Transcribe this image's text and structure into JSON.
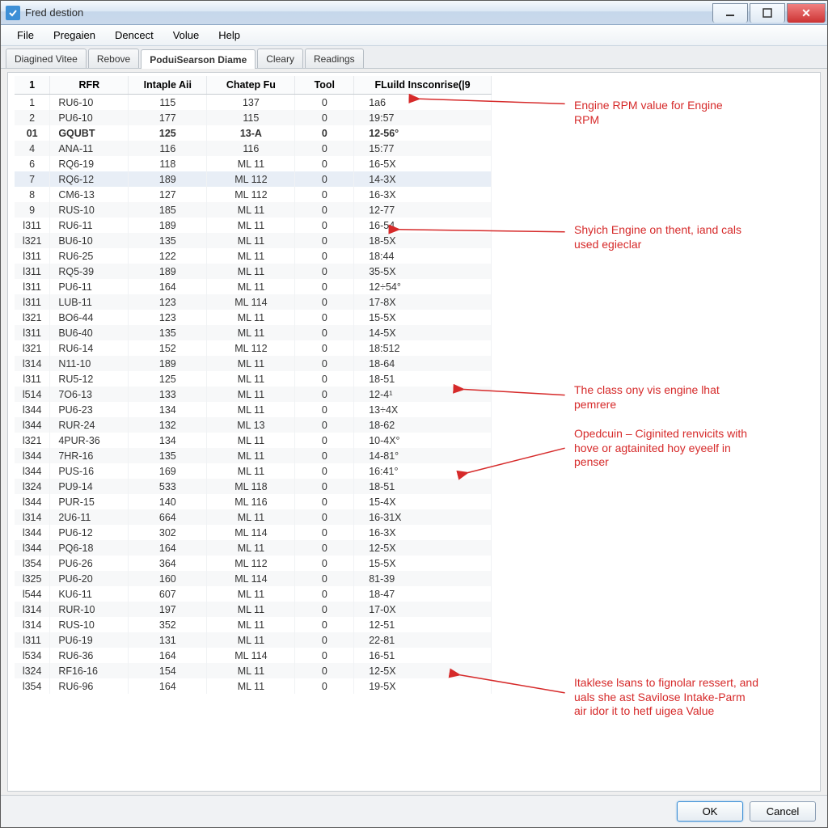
{
  "window": {
    "title": "Fred destion"
  },
  "menu": {
    "file": "File",
    "pregaian": "Pregaien",
    "dencect": "Dencect",
    "volue": "Volue",
    "help": "Help"
  },
  "tabs": {
    "diagined": "Diagined Vitee",
    "rebove": "Rebove",
    "podui": "PoduiSearson Diame",
    "cleary": "Cleary",
    "readings": "Readings"
  },
  "headers": {
    "col0": "1",
    "col1": "RFR",
    "col2": "Intaple Aii",
    "col3": "Chatep Fu",
    "col4": "Tool",
    "col5": "FLuild Insconrise(|9"
  },
  "rows": [
    {
      "n": "1",
      "c1": "RU6-10",
      "c2": "115",
      "c3": "137",
      "c4": "0",
      "c5": "1a6",
      "hl": true
    },
    {
      "n": "2",
      "c1": "PU6-10",
      "c2": "177",
      "c3": "115",
      "c4": "0",
      "c5": "19:57"
    },
    {
      "n": "01",
      "c1": "GQUBT",
      "c2": "125",
      "c3": "13-A",
      "c4": "0",
      "c5": "12-56°",
      "bold": true
    },
    {
      "n": "4",
      "c1": "ANA-11",
      "c2": "116",
      "c3": "116",
      "c4": "0",
      "c5": "15:77"
    },
    {
      "n": "6",
      "c1": "RQ6-19",
      "c2": "118",
      "c3": "ML 11",
      "c4": "0",
      "c5": "16-5X"
    },
    {
      "n": "7",
      "c1": "RQ6-12",
      "c2": "189",
      "c3": "ML 112",
      "c4": "0",
      "c5": "14-3X",
      "sel": true
    },
    {
      "n": "8",
      "c1": "CM6-13",
      "c2": "127",
      "c3": "ML 112",
      "c4": "0",
      "c5": "16-3X"
    },
    {
      "n": "9",
      "c1": "RUS-10",
      "c2": "185",
      "c3": "ML 11",
      "c4": "0",
      "c5": "12-77",
      "hl": true
    },
    {
      "n": "l311",
      "c1": "RU6-11",
      "c2": "189",
      "c3": "ML 11",
      "c4": "0",
      "c5": "16-54"
    },
    {
      "n": "l321",
      "c1": "BU6-10",
      "c2": "135",
      "c3": "ML 11",
      "c4": "0",
      "c5": "18-5X"
    },
    {
      "n": "l311",
      "c1": "RU6-25",
      "c2": "122",
      "c3": "ML 11",
      "c4": "0",
      "c5": "18:44"
    },
    {
      "n": "l311",
      "c1": "RQ5-39",
      "c2": "189",
      "c3": "ML 11",
      "c4": "0",
      "c5": "35-5X"
    },
    {
      "n": "l311",
      "c1": "PU6-11",
      "c2": "164",
      "c3": "ML 11",
      "c4": "0",
      "c5": "12÷54°"
    },
    {
      "n": "l311",
      "c1": "LUB-11",
      "c2": "123",
      "c3": "ML 114",
      "c4": "0",
      "c5": "17-8X"
    },
    {
      "n": "l321",
      "c1": "BO6-44",
      "c2": "123",
      "c3": "ML 11",
      "c4": "0",
      "c5": "15-5X"
    },
    {
      "n": "l311",
      "c1": "BU6-40",
      "c2": "135",
      "c3": "ML 11",
      "c4": "0",
      "c5": "14-5X"
    },
    {
      "n": "l321",
      "c1": "RU6-14",
      "c2": "152",
      "c3": "ML 112",
      "c4": "0",
      "c5": "18:512",
      "hl": true
    },
    {
      "n": "l314",
      "c1": "N11-10",
      "c2": "189",
      "c3": "ML 11",
      "c4": "0",
      "c5": "18-64"
    },
    {
      "n": "l311",
      "c1": "RU5-12",
      "c2": "125",
      "c3": "ML 11",
      "c4": "0",
      "c5": "18-51"
    },
    {
      "n": "l514",
      "c1": "7O6-13",
      "c2": "133",
      "c3": "ML 11",
      "c4": "0",
      "c5": "12-4¹"
    },
    {
      "n": "l344",
      "c1": "PU6-23",
      "c2": "134",
      "c3": "ML 11",
      "c4": "0",
      "c5": "13÷4X"
    },
    {
      "n": "l344",
      "c1": "RUR-24",
      "c2": "132",
      "c3": "ML 13",
      "c4": "0",
      "c5": "18-62",
      "hl": true
    },
    {
      "n": "l321",
      "c1": "4PUR-36",
      "c2": "134",
      "c3": "ML 11",
      "c4": "0",
      "c5": "10-4X°"
    },
    {
      "n": "l344",
      "c1": "7HR-16",
      "c2": "135",
      "c3": "ML 11",
      "c4": "0",
      "c5": "14-81°"
    },
    {
      "n": "l344",
      "c1": "PUS-16",
      "c2": "169",
      "c3": "ML 11",
      "c4": "0",
      "c5": "16:41°"
    },
    {
      "n": "l324",
      "c1": "PU9-14",
      "c2": "533",
      "c3": "ML 118",
      "c4": "0",
      "c5": "18-51"
    },
    {
      "n": "l344",
      "c1": "PUR-15",
      "c2": "140",
      "c3": "ML 116",
      "c4": "0",
      "c5": "15-4X"
    },
    {
      "n": "l314",
      "c1": "2U6-11",
      "c2": "664",
      "c3": "ML 11",
      "c4": "0",
      "c5": "16-31X"
    },
    {
      "n": "l344",
      "c1": "PU6-12",
      "c2": "302",
      "c3": "ML 114",
      "c4": "0",
      "c5": "16-3X"
    },
    {
      "n": "l344",
      "c1": "PQ6-18",
      "c2": "164",
      "c3": "ML 11",
      "c4": "0",
      "c5": "12-5X"
    },
    {
      "n": "l354",
      "c1": "PU6-26",
      "c2": "364",
      "c3": "ML 112",
      "c4": "0",
      "c5": "15-5X"
    },
    {
      "n": "l325",
      "c1": "PU6-20",
      "c2": "160",
      "c3": "ML 114",
      "c4": "0",
      "c5": "81-39"
    },
    {
      "n": "l544",
      "c1": "KU6-11",
      "c2": "607",
      "c3": "ML 11",
      "c4": "0",
      "c5": "18-47",
      "hl": true
    },
    {
      "n": "l314",
      "c1": "RUR-10",
      "c2": "197",
      "c3": "ML 11",
      "c4": "0",
      "c5": "17-0X"
    },
    {
      "n": "l314",
      "c1": "RUS-10",
      "c2": "352",
      "c3": "ML 11",
      "c4": "0",
      "c5": "12-51"
    },
    {
      "n": "l311",
      "c1": "PU6-19",
      "c2": "131",
      "c3": "ML 11",
      "c4": "0",
      "c5": "22-81"
    },
    {
      "n": "l534",
      "c1": "RU6-36",
      "c2": "164",
      "c3": "ML 114",
      "c4": "0",
      "c5": "16-51"
    },
    {
      "n": "l324",
      "c1": "RF16-16",
      "c2": "154",
      "c3": "ML 11",
      "c4": "0",
      "c5": "12-5X"
    },
    {
      "n": "l354",
      "c1": "RU6-96",
      "c2": "164",
      "c3": "ML 11",
      "c4": "0",
      "c5": "19-5X"
    }
  ],
  "annotations": {
    "n1": "Engine RPM value for Engine RPM",
    "n2": "Shyich Engine on thent, iand cals used egieclar",
    "n3": "The class ony vis engine lhat pemrere",
    "n4": "Opedcuin – Ciginited renvicits with hove or agtainited hoy eyeelf in penser",
    "n5": "Itaklese lsans to fignolar ressert, and uals she ast Savilose Intake-Parm air idor it to hetf uigea Value"
  },
  "buttons": {
    "ok": "OK",
    "cancel": "Cancel"
  }
}
